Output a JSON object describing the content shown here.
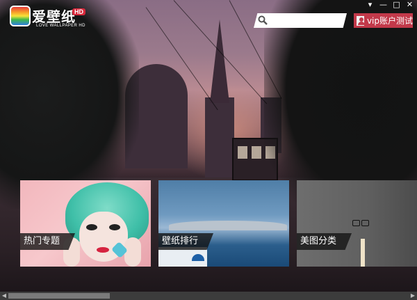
{
  "app": {
    "logo_text": "爱壁纸",
    "logo_badge": "HD",
    "logo_subtitle": "LOVE WALLPAPER HD"
  },
  "search": {
    "placeholder": "",
    "value": ""
  },
  "account": {
    "label": "vip账户测试"
  },
  "window_controls": {
    "menu": "▾",
    "minimize": "—",
    "maximize": "□",
    "close": "✕"
  },
  "tiles": [
    {
      "label": "热门专题"
    },
    {
      "label": "壁纸排行"
    },
    {
      "label": "美图分类"
    }
  ],
  "colors": {
    "accent": "#c2394a",
    "label_bg": "#141414"
  }
}
